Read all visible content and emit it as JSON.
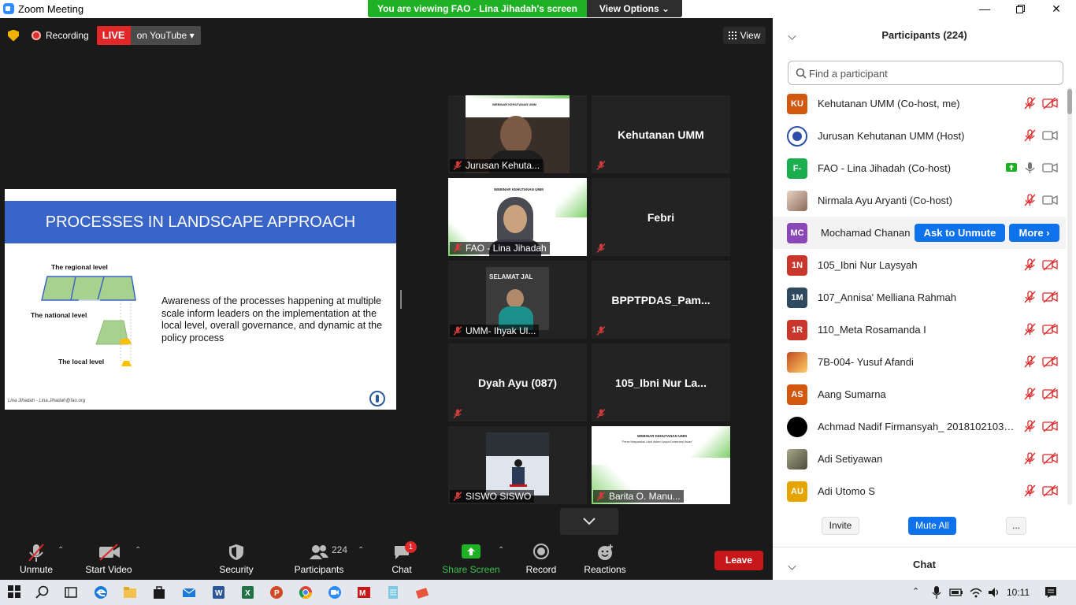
{
  "window": {
    "title": "Zoom Meeting"
  },
  "banner": {
    "viewing": "You are viewing FAO - Lina Jihadah's screen",
    "view_options": "View Options"
  },
  "topbar": {
    "recording": "Recording",
    "live": "LIVE",
    "on_youtube": "on YouTube",
    "view": "View"
  },
  "slide": {
    "title": "PROCESSES IN LANDSCAPE APPROACH",
    "level_regional": "The regional level",
    "level_national": "The national level",
    "level_local": "The local level",
    "body": "Awareness of the processes happening at multiple scale inform leaders on the implementation at the local level, overall governance, and dynamic at the policy process",
    "footer": "Lina Jihadah - Lina.Jihadah@fao.org"
  },
  "gallery": [
    {
      "label": "Jurusan Kehuta...",
      "type": "video"
    },
    {
      "label": "",
      "name": "Kehutanan UMM",
      "type": "name"
    },
    {
      "label": "FAO - Lina Jihadah",
      "type": "video",
      "active": true
    },
    {
      "label": "",
      "name": "Febri",
      "type": "name"
    },
    {
      "label": "UMM- Ihyak Ul...",
      "type": "video"
    },
    {
      "label": "",
      "name": "BPPTPDAS_Pam...",
      "type": "name"
    },
    {
      "label": "",
      "name": "Dyah Ayu (087)",
      "type": "name"
    },
    {
      "label": "",
      "name": "105_Ibni Nur La...",
      "type": "name"
    },
    {
      "label": "SISWO SISWO",
      "type": "video"
    },
    {
      "label": "Barita O. Manu...",
      "type": "video"
    }
  ],
  "tile_text": {
    "webinar": "WEBINAR KEHUTANAN UMM",
    "webinar_sub": "\"Peran Masyarakat Lokal dalam Upaya Konservasi Hutan\"",
    "selamat": "SELAMAT JAL"
  },
  "controls": {
    "unmute": "Unmute",
    "start_video": "Start Video",
    "security": "Security",
    "participants": "Participants",
    "participants_count": "224",
    "chat": "Chat",
    "chat_badge": "1",
    "share_screen": "Share Screen",
    "record": "Record",
    "reactions": "Reactions",
    "leave": "Leave"
  },
  "panel": {
    "title": "Participants (224)",
    "search_placeholder": "Find a participant",
    "ask_to_unmute": "Ask to Unmute",
    "more": "More",
    "participants": [
      {
        "initials": "KU",
        "color": "#d2570f",
        "name": "Kehutanan UMM (Co-host, me)",
        "mic": "muted",
        "video": "off"
      },
      {
        "initials": "",
        "color": "#ffffff",
        "name": "Jurusan Kehutanan UMM (Host)",
        "mic": "muted",
        "video": "on"
      },
      {
        "initials": "F-",
        "color": "#1bae4f",
        "name": "FAO - Lina Jihadah (Co-host)",
        "mic": "on",
        "video": "on",
        "share": true
      },
      {
        "initials": "",
        "color": "#c9a18a",
        "name": "Nirmala Ayu Aryanti (Co-host)",
        "mic": "muted",
        "video": "on"
      },
      {
        "initials": "MC",
        "color": "#8a47b8",
        "name": "Mochamad Chanan",
        "hover": true
      },
      {
        "initials": "1N",
        "color": "#c9362b",
        "name": "105_Ibni Nur Laysyah",
        "mic": "muted",
        "video": "off"
      },
      {
        "initials": "1M",
        "color": "#2f4a5e",
        "name": "107_Annisa' Melliana Rahmah",
        "mic": "muted",
        "video": "off"
      },
      {
        "initials": "1R",
        "color": "#c9362b",
        "name": "110_Meta Rosamanda I",
        "mic": "muted",
        "video": "off"
      },
      {
        "initials": "",
        "color": "#c24a1e",
        "name": "7B-004- Yusuf Afandi",
        "mic": "muted",
        "video": "off"
      },
      {
        "initials": "AS",
        "color": "#d2570f",
        "name": "Aang Sumarna",
        "mic": "muted",
        "video": "off"
      },
      {
        "initials": "",
        "color": "#000000",
        "name": "Achmad Nadif Firmansyah_ 201810210311...",
        "mic": "muted",
        "video": "off"
      },
      {
        "initials": "",
        "color": "#6b6b5a",
        "name": "Adi Setiyawan",
        "mic": "muted",
        "video": "off"
      },
      {
        "initials": "AU",
        "color": "#e6a400",
        "name": "Adi Utomo S",
        "mic": "muted",
        "video": "off"
      }
    ],
    "invite": "Invite",
    "mute_all": "Mute All",
    "ellipsis": "...",
    "chat": "Chat"
  },
  "taskbar": {
    "time": "10:11"
  }
}
